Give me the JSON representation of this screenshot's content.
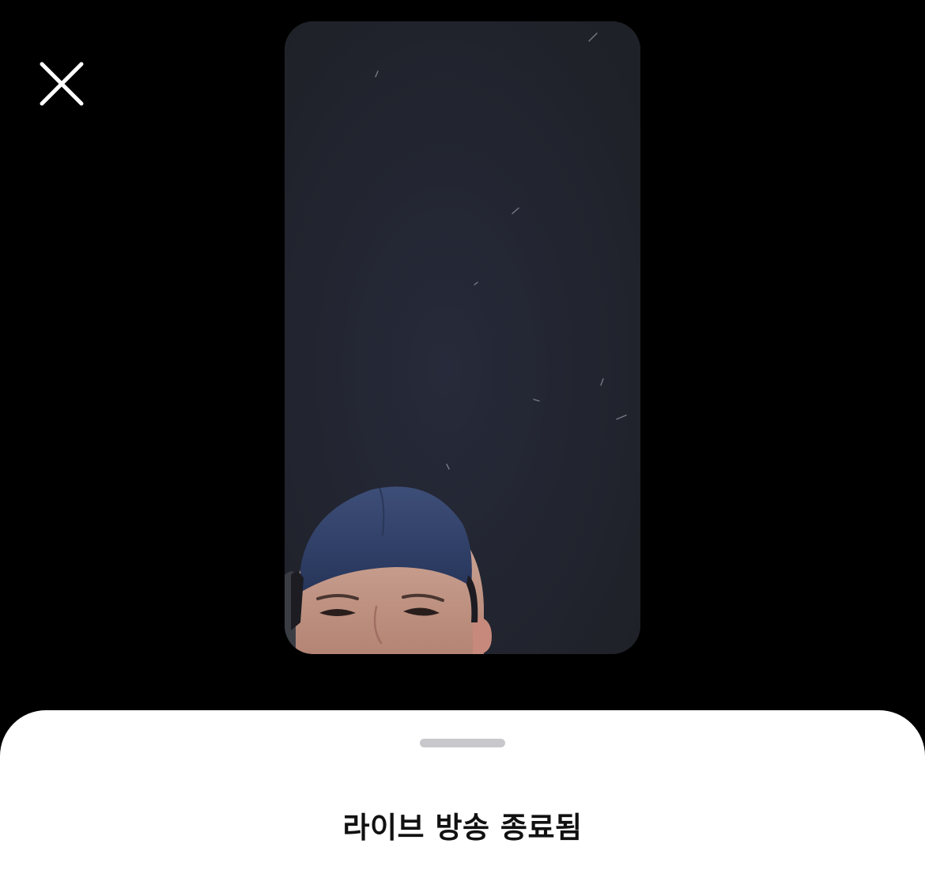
{
  "icons": {
    "close": "close-icon"
  },
  "preview": {
    "image": "live-broadcast-preview-thumbnail"
  },
  "sheet": {
    "title": "라이브 방송 종료됨"
  },
  "colors": {
    "background": "#000000",
    "sheet": "#ffffff",
    "grabber": "#c8c8cc",
    "title": "#111111"
  }
}
